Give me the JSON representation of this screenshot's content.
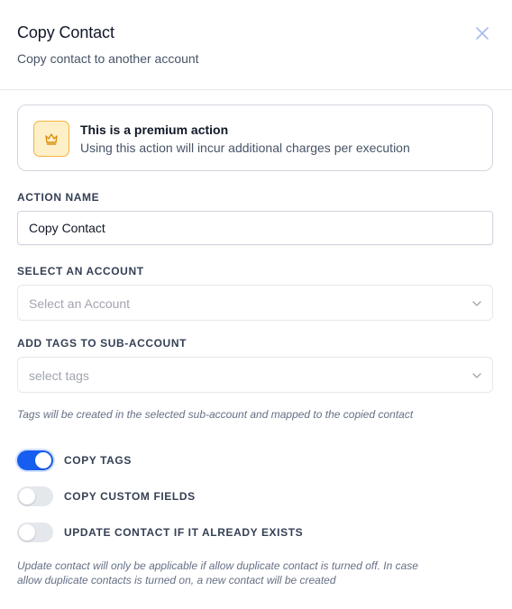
{
  "header": {
    "title": "Copy Contact",
    "subtitle": "Copy contact to another account",
    "close_icon": "close-icon"
  },
  "premium": {
    "icon": "crown-icon",
    "title": "This is a premium action",
    "description": "Using this action will incur additional charges per execution"
  },
  "action_name": {
    "label": "ACTION NAME",
    "value": "Copy Contact"
  },
  "account": {
    "label": "SELECT AN ACCOUNT",
    "placeholder": "Select an Account"
  },
  "tags": {
    "label": "ADD TAGS TO SUB-ACCOUNT",
    "placeholder": "select tags",
    "hint": "Tags will be created in the selected sub-account and mapped to the copied contact"
  },
  "toggles": [
    {
      "label": "COPY TAGS",
      "on": true
    },
    {
      "label": "COPY CUSTOM FIELDS",
      "on": false
    },
    {
      "label": "UPDATE CONTACT IF IT ALREADY EXISTS",
      "on": false
    }
  ],
  "footer_hint": {
    "line1": "Update contact will only be applicable if allow duplicate contact is turned off. In case",
    "line2": "allow duplicate contacts is turned on, a new contact will be created"
  },
  "colors": {
    "accent": "#155eef",
    "premium_bg": "#fdf0c8",
    "premium_border": "#f5b13d"
  }
}
